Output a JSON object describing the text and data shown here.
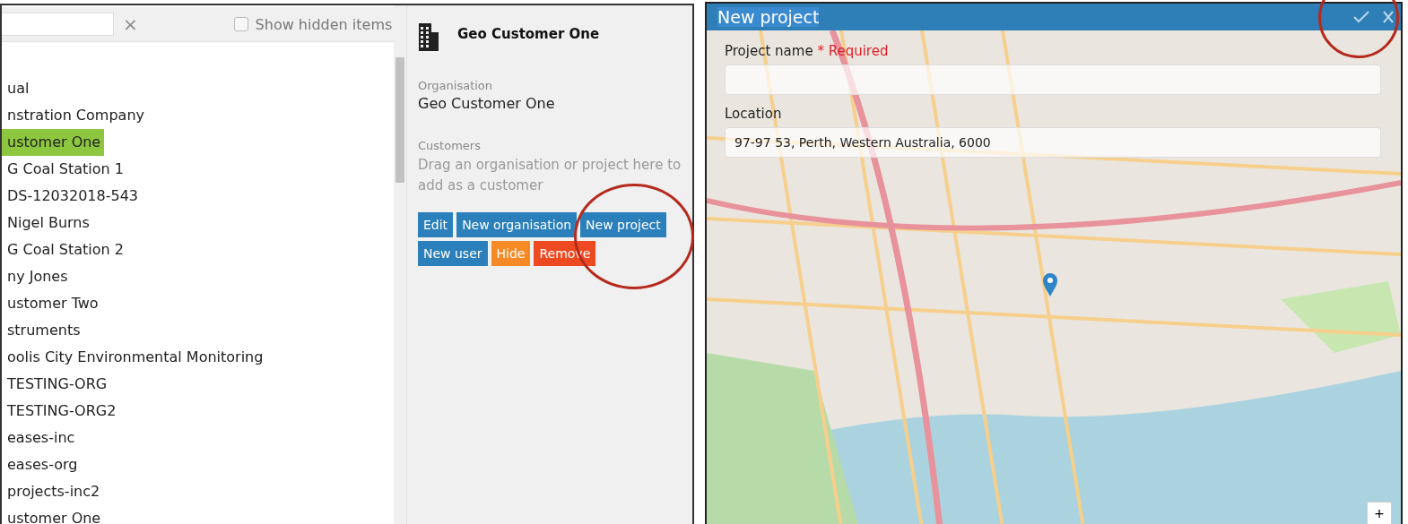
{
  "organisations_panel": {
    "clear_button": "×",
    "show_hidden": {
      "label": "Show hidden items",
      "checked": false
    },
    "items": [
      {
        "label": "ual",
        "selected": false
      },
      {
        "label": "nstration Company",
        "selected": false
      },
      {
        "label": "ustomer One",
        "selected": true
      },
      {
        "label": "G Coal Station 1",
        "selected": false
      },
      {
        "label": "DS-12032018-543",
        "selected": false
      },
      {
        "label": "Nigel Burns",
        "selected": false
      },
      {
        "label": "G Coal Station 2",
        "selected": false
      },
      {
        "label": "ny Jones",
        "selected": false
      },
      {
        "label": "ustomer Two",
        "selected": false
      },
      {
        "label": "struments",
        "selected": false
      },
      {
        "label": "oolis City Environmental Monitoring",
        "selected": false
      },
      {
        "label": "TESTING-ORG",
        "selected": false
      },
      {
        "label": "TESTING-ORG2",
        "selected": false
      },
      {
        "label": "eases-inc",
        "selected": false
      },
      {
        "label": "eases-org",
        "selected": false
      },
      {
        "label": "projects-inc2",
        "selected": false
      },
      {
        "label": "ustomer One",
        "selected": false
      }
    ]
  },
  "details_panel": {
    "title": "Geo Customer One",
    "organisation_label": "Organisation",
    "organisation_value": "Geo Customer One",
    "customers_label": "Customers",
    "customers_hint": "Drag an organisation or project here to add as a customer",
    "buttons": [
      {
        "label": "Edit",
        "kind": "primary"
      },
      {
        "label": "New organisation",
        "kind": "primary"
      },
      {
        "label": "New project",
        "kind": "primary"
      },
      {
        "label": "New user",
        "kind": "primary"
      },
      {
        "label": "Hide",
        "kind": "warning"
      },
      {
        "label": "Remove",
        "kind": "danger"
      }
    ]
  },
  "new_project_dialog": {
    "title": "New project",
    "project_name_label": "Project name",
    "required_mark": "* Required",
    "location_label": "Location",
    "location_value": "97-97 53, Perth, Western Australia, 6000",
    "zoom_in": "+"
  }
}
